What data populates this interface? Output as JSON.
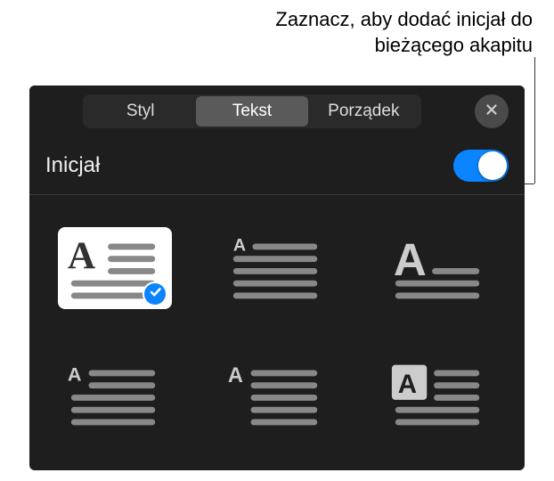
{
  "callout": {
    "line1": "Zaznacz, aby dodać inicjał do",
    "line2": "bieżącego akapitu"
  },
  "tabs": {
    "styl": "Styl",
    "tekst": "Tekst",
    "porzadek": "Porządek",
    "active": "tekst"
  },
  "section": {
    "title": "Inicjał",
    "toggle_on": true
  },
  "options": {
    "selected_index": 0,
    "items": [
      {
        "name": "dropcap-large-wrap"
      },
      {
        "name": "dropcap-small-inline"
      },
      {
        "name": "dropcap-raised"
      },
      {
        "name": "dropcap-margin-small"
      },
      {
        "name": "dropcap-margin-medium"
      },
      {
        "name": "dropcap-boxed"
      }
    ]
  },
  "colors": {
    "accent": "#0a84ff",
    "panel_bg": "#1e1e1e",
    "line": "#7a7a7a"
  }
}
